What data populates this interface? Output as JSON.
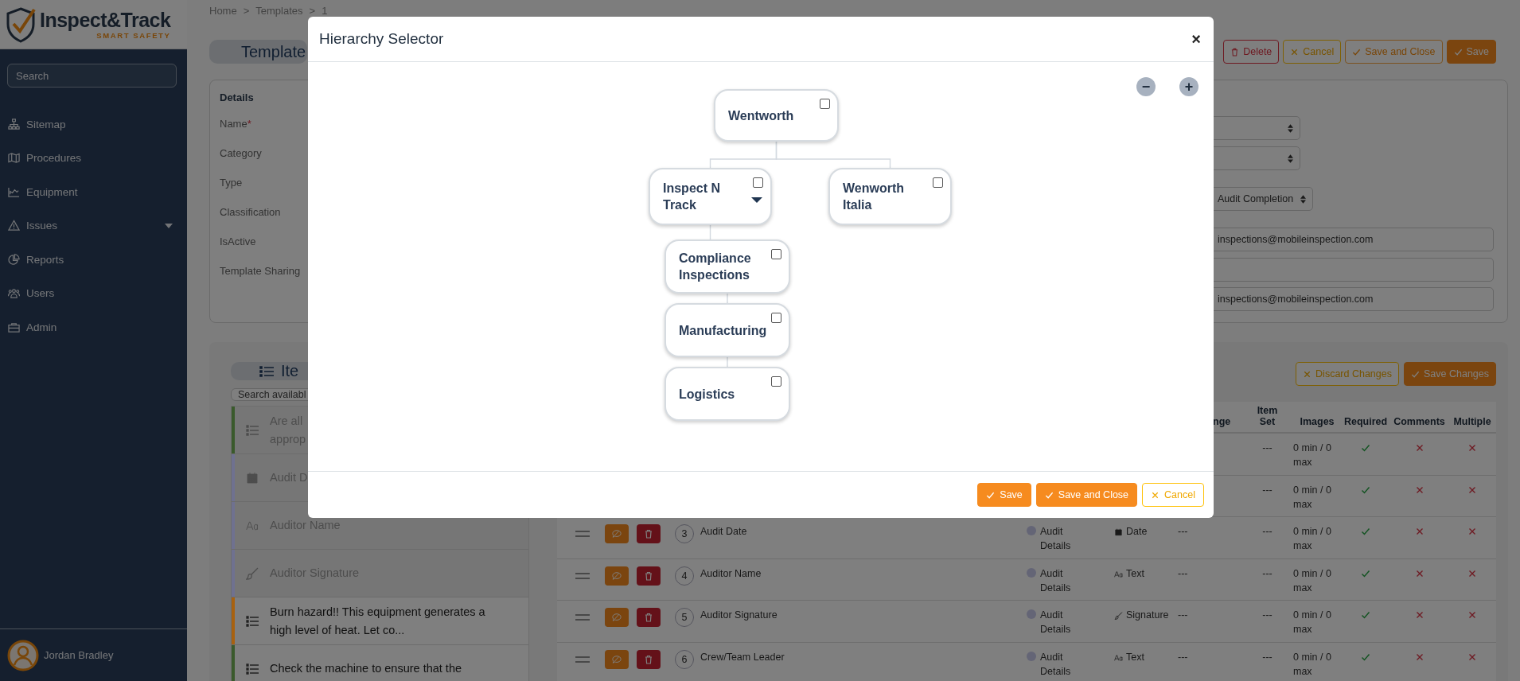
{
  "sidebar": {
    "logo": {
      "name": "Inspect&Track",
      "tagline": "SMART SAFETY"
    },
    "search": {
      "placeholder": "Search"
    },
    "items": [
      {
        "label": "Sitemap",
        "expandable": false
      },
      {
        "label": "Procedures",
        "expandable": false
      },
      {
        "label": "Equipment",
        "expandable": false
      },
      {
        "label": "Issues",
        "expandable": true
      },
      {
        "label": "Reports",
        "expandable": false
      },
      {
        "label": "Users",
        "expandable": false
      },
      {
        "label": "Admin",
        "expandable": false
      }
    ],
    "user": {
      "name": "Jordan Bradley"
    }
  },
  "breadcrumb": {
    "items": [
      "Home",
      "Templates",
      "1"
    ],
    "separator": ">"
  },
  "title": "Template",
  "toolbar": [
    {
      "label": "Delete",
      "kind": "delete"
    },
    {
      "label": "Cancel",
      "kind": "cancel"
    },
    {
      "label": "Save and Close",
      "kind": "save-close"
    },
    {
      "label": "Save",
      "kind": "save"
    }
  ],
  "details": {
    "heading": "Details",
    "fields": [
      {
        "label": "Name",
        "required_mark": "*"
      },
      {
        "label": "Category"
      },
      {
        "label": "Type"
      },
      {
        "label": "Classification"
      },
      {
        "label": "IsActive"
      },
      {
        "label": "Template Sharing"
      }
    ],
    "controls": [
      {
        "kind": "select"
      },
      {
        "kind": "select"
      },
      {
        "kind": "select",
        "value": "Audit Completion"
      },
      {
        "kind": "input",
        "value": "inspections@mobileinspection.com"
      },
      {
        "kind": "input"
      },
      {
        "kind": "input",
        "value": "inspections@mobileinspection.com"
      }
    ]
  },
  "items_panel": {
    "title": "Ite",
    "search": {
      "placeholder": "Search availabl"
    },
    "items": [
      {
        "text": "Are all\napprop",
        "kind": "choice",
        "color": "#3a5a2c",
        "added": true
      },
      {
        "text": "Audit D",
        "kind": "date",
        "color": "#6f7190",
        "added": true
      },
      {
        "text": "Auditor Name",
        "kind": "text",
        "color": "#6f7190",
        "added": true
      },
      {
        "text": "Auditor Signature",
        "kind": "signature",
        "color": "#6f7190",
        "added": true
      },
      {
        "text": "Burn hazard!! This equipment generates a high level of heat. Let co...",
        "kind": "choice",
        "color": "#a8610f",
        "added": false
      },
      {
        "text": "Check the machine to ensure that the",
        "kind": "choice",
        "color": "#3a5a2c",
        "added": false
      }
    ]
  },
  "table_actions": [
    {
      "label": "Discard Changes",
      "kind": "discard"
    },
    {
      "label": "Save Changes",
      "kind": "save"
    }
  ],
  "table": {
    "columns": {
      "range": "nge",
      "item_set": "Item Set",
      "images": "Images",
      "required": "Required",
      "comments": "Comments",
      "multiple": "Multiple"
    },
    "rows": [
      {
        "item_set": "---",
        "images": "0 min / 0 max",
        "required": true,
        "comments": false,
        "multiple": false
      },
      {
        "item_set": "---",
        "images": "0 min / 0 max",
        "required": true,
        "comments": false,
        "multiple": false
      },
      {
        "number": "3",
        "name": "Audit Date",
        "group": "Audit Details",
        "type": "Date",
        "kind": "date",
        "range": "---",
        "item_set": "---",
        "images": "0 min / 0 max",
        "required": true,
        "comments": false,
        "multiple": false
      },
      {
        "number": "4",
        "name": "Auditor Name",
        "group": "Audit Details",
        "type": "Text",
        "kind": "text",
        "range": "---",
        "item_set": "---",
        "images": "0 min / 0 max",
        "required": true,
        "comments": false,
        "multiple": false
      },
      {
        "number": "5",
        "name": "Auditor Signature",
        "group": "Audit Details",
        "type": "Signature",
        "kind": "signature",
        "range": "---",
        "item_set": "---",
        "images": "0 min / 0 max",
        "required": true,
        "comments": false,
        "multiple": false
      },
      {
        "number": "6",
        "name": "Crew/Team Leader",
        "group": "Audit Details",
        "type": "Text",
        "kind": "text",
        "range": "---",
        "item_set": "---",
        "images": "0 min / 0 max",
        "required": true,
        "comments": false,
        "multiple": false
      }
    ]
  },
  "modal": {
    "title": "Hierarchy Selector",
    "close": "×",
    "zoom": [
      {
        "label": "−"
      },
      {
        "label": "+"
      }
    ],
    "tree": {
      "label": "Wentworth",
      "checked": false,
      "children": [
        {
          "label": "Inspect N Track",
          "checked": false,
          "expanded": true,
          "children": [
            {
              "label": "Compliance Inspections",
              "checked": false
            },
            {
              "label": "Manufacturing",
              "checked": false
            },
            {
              "label": "Logistics",
              "checked": false
            }
          ]
        },
        {
          "label": "Wenworth Italia",
          "checked": false
        }
      ]
    },
    "buttons": [
      {
        "label": "Save",
        "kind": "save"
      },
      {
        "label": "Save and Close",
        "kind": "save-close"
      },
      {
        "label": "Cancel",
        "kind": "cancel"
      }
    ]
  }
}
